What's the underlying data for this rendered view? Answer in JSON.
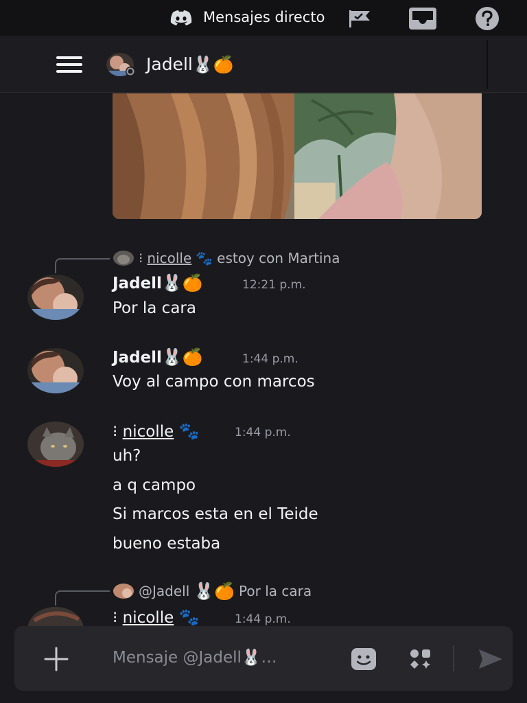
{
  "topbar": {
    "title": "Mensajes directo",
    "icons": [
      "discord-logo-icon",
      "flag-icon",
      "inbox-icon",
      "help-icon"
    ]
  },
  "header": {
    "name": "Jadell",
    "name_emojis": "🐰🍊",
    "icons": [
      "hamburger-menu-icon"
    ]
  },
  "messages": [
    {
      "reply": {
        "author": "nicolle",
        "prefix": "⁝ ",
        "tag": "🐾",
        "text": "estoy con Martina"
      },
      "author": "Jadell",
      "author_emojis": "🐰🍊",
      "time": "12:21 p.m.",
      "lines": [
        "Por la cara"
      ]
    },
    {
      "author": "Jadell",
      "author_emojis": "🐰🍊",
      "time": "1:44 p.m.",
      "lines": [
        "Voy al campo con marcos"
      ]
    },
    {
      "author": "nicolle",
      "author_prefix": "⁝ ",
      "author_tag": "🐾",
      "time": "1:44 p.m.",
      "lines": [
        "uh?",
        "a q campo",
        "Si marcos esta en el Teide",
        "bueno estaba"
      ]
    },
    {
      "reply": {
        "author": "@Jadell",
        "tag": "🐰🍊",
        "text": "Por la cara"
      },
      "author": "nicolle",
      "author_prefix": "⁝ ",
      "author_tag": "🐾",
      "time": "1:44 p.m."
    }
  ],
  "composer": {
    "placeholder": "Mensaje @Jadell🐰…",
    "icons": [
      "plus-icon",
      "emoji-icon",
      "apps-icon",
      "send-icon"
    ]
  },
  "colors": {
    "background": "#1a1a1e",
    "topbar": "#121214",
    "composer": "#26262b",
    "muted": "#9a9ba3"
  }
}
